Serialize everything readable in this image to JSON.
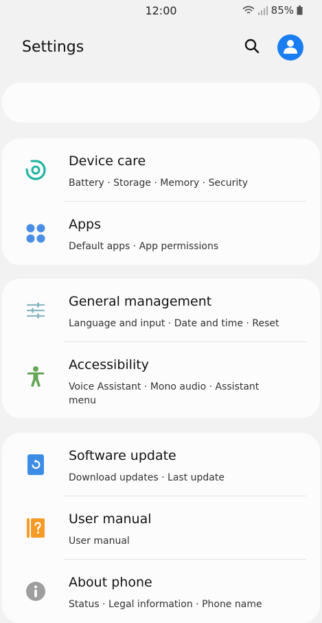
{
  "status_bar": {
    "time": "12:00",
    "battery": "85%"
  },
  "header": {
    "title": "Settings"
  },
  "sections": [
    {
      "items": [
        {
          "title": "Device care",
          "subtitle": "Battery · Storage · Memory · Security",
          "icon": "device-care-icon",
          "color": "#1fb3a0"
        },
        {
          "title": "Apps",
          "subtitle": "Default apps · App permissions",
          "icon": "apps-icon",
          "color": "#4a8ee8"
        }
      ]
    },
    {
      "items": [
        {
          "title": "General management",
          "subtitle": "Language and input · Date and time · Reset",
          "icon": "sliders-icon",
          "color": "#8ab7c2"
        },
        {
          "title": "Accessibility",
          "subtitle": "Voice Assistant · Mono audio · Assistant menu",
          "icon": "accessibility-icon",
          "color": "#66a656"
        }
      ]
    },
    {
      "items": [
        {
          "title": "Software update",
          "subtitle": "Download updates · Last update",
          "icon": "software-update-icon",
          "color": "#3d8de6"
        },
        {
          "title": "User manual",
          "subtitle": "User manual",
          "icon": "user-manual-icon",
          "color": "#f59a26"
        },
        {
          "title": "About phone",
          "subtitle": "Status · Legal information · Phone name",
          "icon": "info-icon",
          "color": "#9e9e9e"
        }
      ]
    }
  ],
  "colors": {
    "accent": "#1a7ef0",
    "background": "#f2f2f2",
    "card": "#fcfcfc"
  }
}
